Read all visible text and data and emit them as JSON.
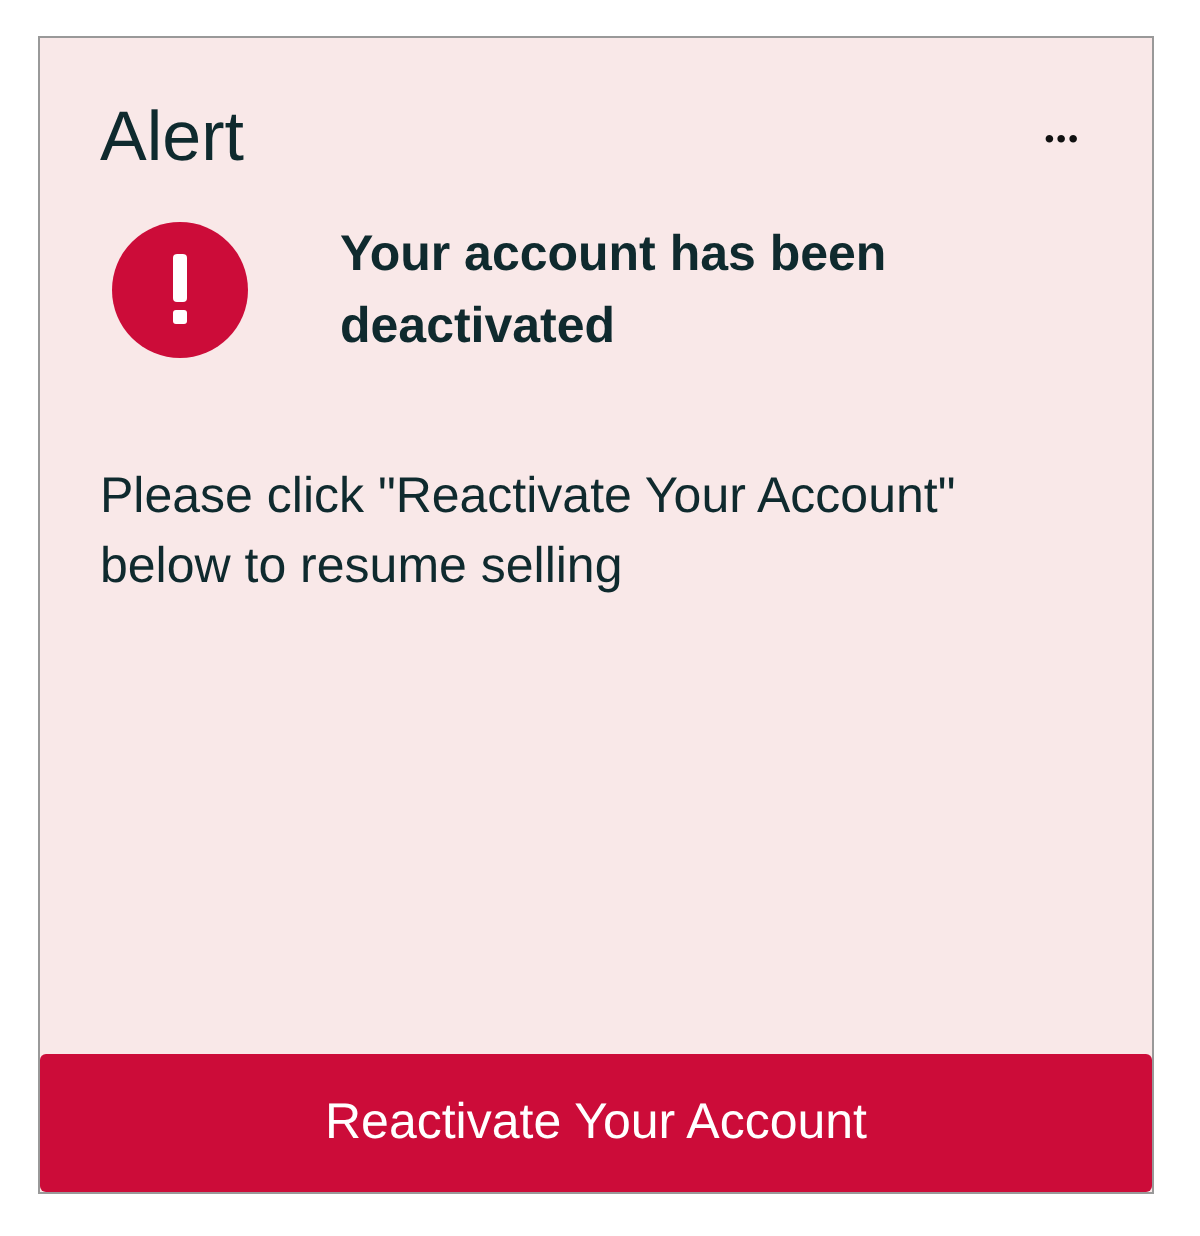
{
  "card": {
    "title": "Alert",
    "menu": "•••",
    "alert": {
      "heading": "Your account has been deactivated",
      "message": "Please click \"Reactivate Your Account\" below to resume selling"
    },
    "button": "Reactivate Your Account"
  }
}
